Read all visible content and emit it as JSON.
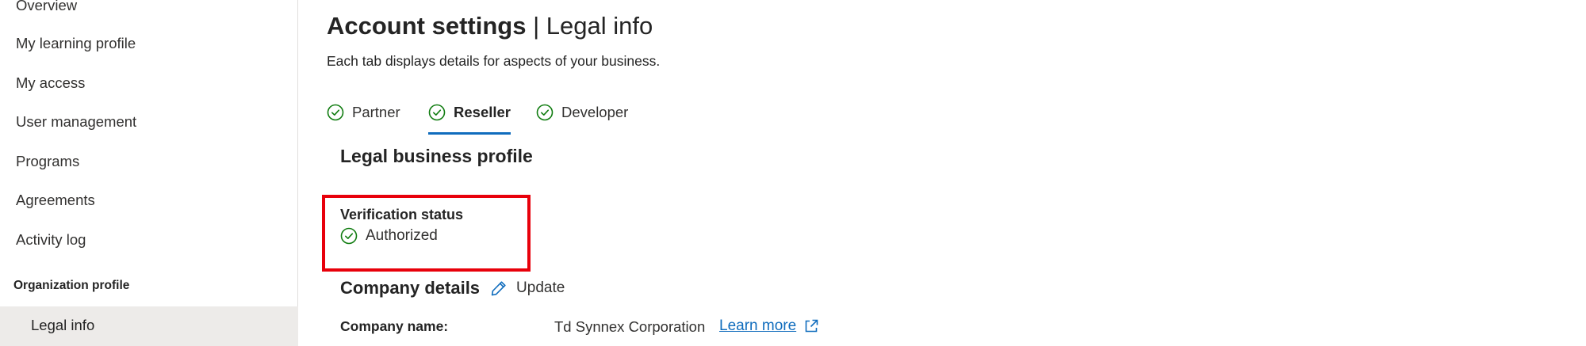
{
  "sidebar": {
    "items": [
      {
        "label": "Overview"
      },
      {
        "label": "My learning profile"
      },
      {
        "label": "My access"
      },
      {
        "label": "User management"
      },
      {
        "label": "Programs"
      },
      {
        "label": "Agreements"
      },
      {
        "label": "Activity log"
      }
    ],
    "section_heading": "Organization profile",
    "active_item": "Legal info"
  },
  "header": {
    "title_strong": "Account settings",
    "title_separator": " | ",
    "title_light": "Legal info",
    "subtitle": "Each tab displays details for aspects of your business."
  },
  "tabs": [
    {
      "label": "Partner",
      "icon": "check-circle-icon"
    },
    {
      "label": "Reseller",
      "icon": "check-circle-icon",
      "selected": true
    },
    {
      "label": "Developer",
      "icon": "check-circle-icon"
    }
  ],
  "profile": {
    "section_title": "Legal business profile",
    "verification_label": "Verification status",
    "verification_value": "Authorized",
    "company_details_title": "Company details",
    "update_label": "Update",
    "company_name_label": "Company name:",
    "company_name_value": "Td Synnex Corporation",
    "learn_more_label": "Learn more"
  },
  "colors": {
    "accent": "#0f6cbd",
    "success": "#107c10",
    "highlight": "#e8000b",
    "active_nav_bg": "#edebe9"
  }
}
